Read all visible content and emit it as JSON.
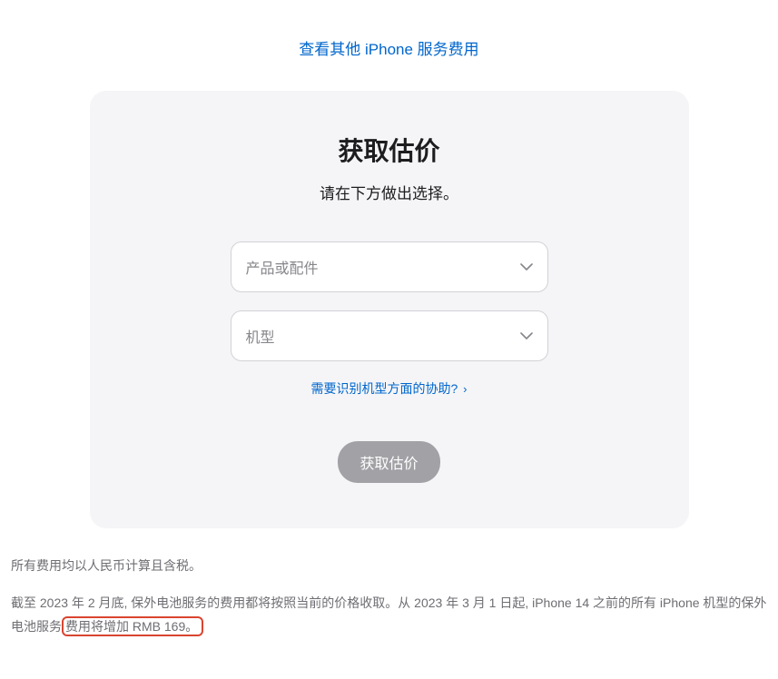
{
  "topLink": {
    "label": "查看其他 iPhone 服务费用"
  },
  "card": {
    "title": "获取估价",
    "subtitle": "请在下方做出选择。",
    "select1": {
      "placeholder": "产品或配件"
    },
    "select2": {
      "placeholder": "机型"
    },
    "helpLink": {
      "label": "需要识别机型方面的协助?"
    },
    "submitLabel": "获取估价"
  },
  "footer": {
    "line1": "所有费用均以人民币计算且含税。",
    "line2_part1": "截至 2023 年 2 月底, 保外电池服务的费用都将按照当前的价格收取。从 2023 年 3 月 1 日起, iPhone 14 之前的所有 iPhone 机型的保外电池服务",
    "line2_highlight": "费用将增加 RMB 169。"
  }
}
